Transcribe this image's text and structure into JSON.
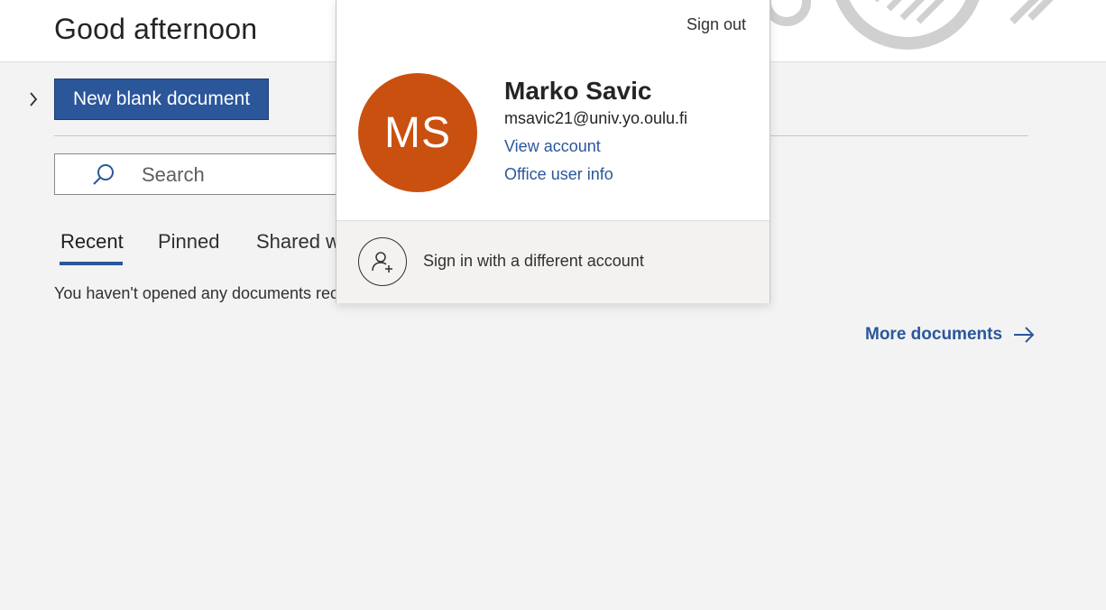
{
  "header": {
    "greeting": "Good afternoon"
  },
  "actions": {
    "new_blank_document": "New blank document"
  },
  "search": {
    "placeholder": "Search"
  },
  "tabs": [
    {
      "label": "Recent",
      "active": true
    },
    {
      "label": "Pinned",
      "active": false
    },
    {
      "label": "Shared w",
      "active": false
    }
  ],
  "recent": {
    "empty_message": "You haven't opened any documents rec"
  },
  "more_documents": {
    "label": "More documents",
    "icon": "arrow-right-icon"
  },
  "account_panel": {
    "sign_out": "Sign out",
    "avatar_initials": "MS",
    "avatar_color": "#ca5010",
    "name": "Marko Savic",
    "email": "msavic21@univ.yo.oulu.fi",
    "view_account": "View account",
    "office_user_info": "Office user info",
    "sign_in_different": "Sign in with a different account",
    "sign_in_icon": "add-person-icon"
  },
  "colors": {
    "accent": "#2b579a",
    "background": "#f3f3f3"
  }
}
